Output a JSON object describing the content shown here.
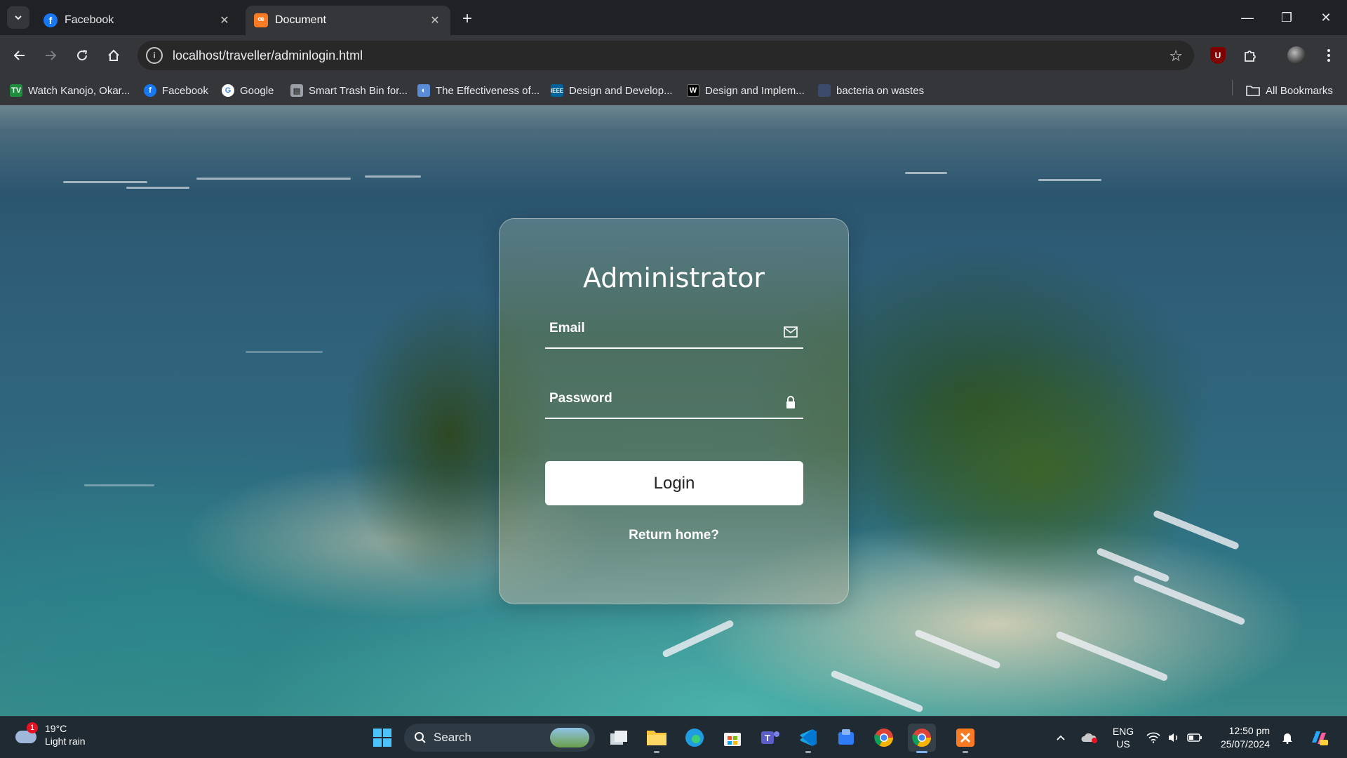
{
  "browser": {
    "tabs": [
      {
        "title": "Facebook",
        "favicon": "facebook-icon",
        "active": false
      },
      {
        "title": "Document",
        "favicon": "xampp-icon",
        "active": true
      }
    ],
    "url": "localhost/traveller/adminlogin.html",
    "bookmarks": [
      {
        "label": "Watch Kanojo, Okar...",
        "icon": "tv-icon",
        "color": "#1e8e3e"
      },
      {
        "label": "Facebook",
        "icon": "facebook-icon",
        "color": "#1877f2"
      },
      {
        "label": "Google",
        "icon": "google-icon",
        "color": "#ffffff"
      },
      {
        "label": "Smart Trash Bin for...",
        "icon": "document-icon",
        "color": "#9aa0a6"
      },
      {
        "label": "The Effectiveness of...",
        "icon": "globe-icon",
        "color": "#5a8bd6"
      },
      {
        "label": "Design and Develop...",
        "icon": "ieee-icon",
        "color": "#00629b"
      },
      {
        "label": "Design and Implem...",
        "icon": "w-icon",
        "color": "#000000"
      },
      {
        "label": "bacteria on wastes",
        "icon": "page-icon",
        "color": "#3c4a6b"
      }
    ],
    "all_bookmarks_label": "All Bookmarks"
  },
  "login": {
    "title": "Administrator",
    "email_label": "Email",
    "password_label": "Password",
    "login_button": "Login",
    "return_link": "Return home?"
  },
  "taskbar": {
    "weather_temp": "19°C",
    "weather_desc": "Light rain",
    "weather_badge": "1",
    "search_label": "Search",
    "language": "ENG",
    "region": "US",
    "time": "12:50 pm",
    "date": "25/07/2024"
  }
}
